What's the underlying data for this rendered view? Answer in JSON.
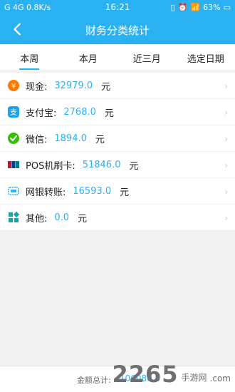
{
  "status": {
    "carrier_left": "G",
    "network": "4G",
    "speed": "0.8K/s",
    "time": "16:21",
    "battery": "63%"
  },
  "app": {
    "title": "财务分类统计"
  },
  "tabs": [
    {
      "label": "本周"
    },
    {
      "label": "本月"
    },
    {
      "label": "近三月"
    },
    {
      "label": "选定日期"
    }
  ],
  "rows": [
    {
      "label": "现金:",
      "amount": "32979.0",
      "unit": "元",
      "icon": "cash-icon",
      "color": "#ff7a00"
    },
    {
      "label": "支付宝:",
      "amount": "2768.0",
      "unit": "元",
      "icon": "alipay-icon",
      "color": "#18a3f0"
    },
    {
      "label": "微信:",
      "amount": "1894.0",
      "unit": "元",
      "icon": "wechat-icon",
      "color": "#34c000"
    },
    {
      "label": "POS机刷卡:",
      "amount": "51846.0",
      "unit": "元",
      "icon": "unionpay-icon",
      "color": "#c4122f"
    },
    {
      "label": "网银转账:",
      "amount": "16593.0",
      "unit": "元",
      "icon": "online-bank-icon",
      "color": "#2ab1f2"
    },
    {
      "label": "其他:",
      "amount": "0.0",
      "unit": "元",
      "icon": "grid-icon",
      "color": "#17a6a6"
    }
  ],
  "footer": {
    "label": "金额总计:",
    "value": "106080.0"
  },
  "watermark": {
    "big": "2265",
    "small": "手游网",
    "domain": ".com"
  }
}
